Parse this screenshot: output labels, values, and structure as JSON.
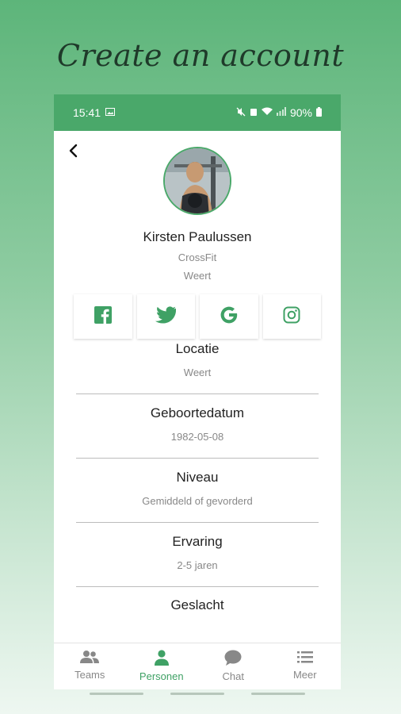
{
  "headline": "Create an account",
  "status_bar": {
    "time": "15:41",
    "battery": "90%"
  },
  "profile": {
    "name": "Kirsten Paulussen",
    "sport": "CrossFit",
    "city": "Weert"
  },
  "social": [
    "facebook-icon",
    "twitter-icon",
    "google-icon",
    "instagram-icon"
  ],
  "sections": [
    {
      "title": "Locatie",
      "value": "Weert"
    },
    {
      "title": "Geboortedatum",
      "value": "1982-05-08"
    },
    {
      "title": "Niveau",
      "value": "Gemiddeld of gevorderd"
    },
    {
      "title": "Ervaring",
      "value": "2-5 jaren"
    },
    {
      "title": "Geslacht",
      "value": ""
    }
  ],
  "tabs": [
    {
      "label": "Teams",
      "icon": "people-icon",
      "active": false
    },
    {
      "label": "Personen",
      "icon": "person-icon",
      "active": true
    },
    {
      "label": "Chat",
      "icon": "chat-icon",
      "active": false
    },
    {
      "label": "Meer",
      "icon": "menu-list-icon",
      "active": false
    }
  ],
  "colors": {
    "accent": "#4aa86a",
    "text": "#222222",
    "muted": "#888888"
  }
}
